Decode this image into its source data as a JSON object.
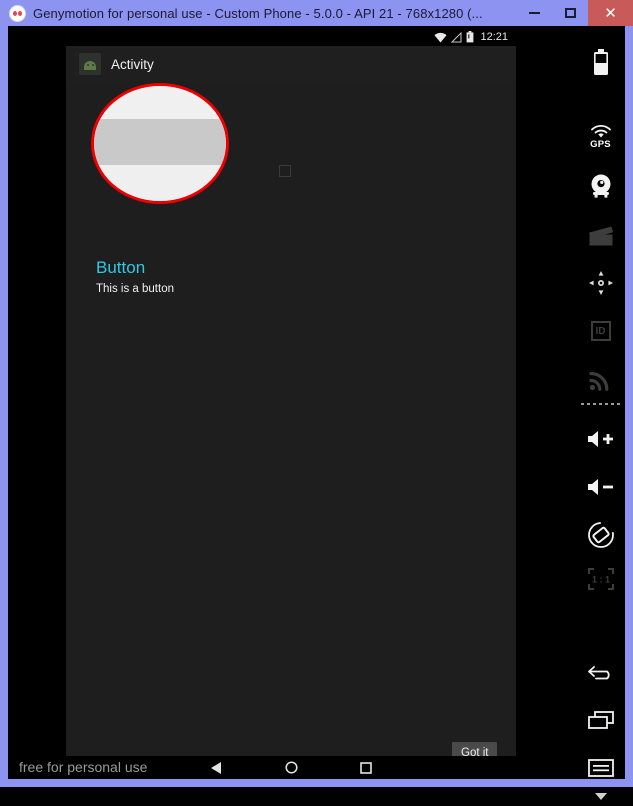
{
  "window": {
    "title": "Genymotion for personal use - Custom Phone - 5.0.0 - API 21 - 768x1280 (...",
    "logo_icon": "genymotion-logo-icon",
    "controls": {
      "minimize_label": "–",
      "maximize_label": "□",
      "close_label": "✕"
    },
    "accent_color": "#8c93f0",
    "close_color": "#c85a5a"
  },
  "android": {
    "status_bar": {
      "wifi_icon": "wifi-icon",
      "signal_icon": "signal-icon",
      "battery_icon": "battery-icon",
      "clock": "12:21"
    },
    "action_bar": {
      "app_icon": "android-app-icon",
      "title": "Activity"
    },
    "content": {
      "button_title": "Button",
      "button_subtitle": "This is a button",
      "button_title_color": "#2ec8e6",
      "placeholder_square_icon": "empty-square-icon",
      "got_it_label": "Got it"
    },
    "nav_bar": {
      "watermark": "free for personal use",
      "back_icon": "back-triangle-icon",
      "home_icon": "home-circle-icon",
      "recent_icon": "recent-square-icon"
    }
  },
  "annotation": {
    "shape": "circle",
    "color": "#ee0000",
    "name": "red-highlight-circle"
  },
  "toolbar": {
    "items": [
      {
        "name": "battery-widget-icon",
        "label": "",
        "enabled": true
      },
      {
        "name": "gps-icon",
        "label": "GPS",
        "enabled": true
      },
      {
        "name": "camera-icon",
        "label": "",
        "enabled": true
      },
      {
        "name": "video-clapperboard-icon",
        "label": "",
        "enabled": false
      },
      {
        "name": "accelerometer-dpad-icon",
        "label": "",
        "enabled": true
      },
      {
        "name": "identifiers-id-icon",
        "label": "ID",
        "enabled": false
      },
      {
        "name": "network-signal-icon",
        "label": "",
        "enabled": false
      },
      {
        "name": "volume-up-icon",
        "label": "",
        "enabled": true
      },
      {
        "name": "volume-down-icon",
        "label": "",
        "enabled": true
      },
      {
        "name": "rotate-screen-icon",
        "label": "",
        "enabled": true
      },
      {
        "name": "scale-one-to-one-icon",
        "label": "1 : 1",
        "enabled": false
      },
      {
        "name": "back-arrow-icon",
        "label": "",
        "enabled": true
      },
      {
        "name": "recent-apps-icon",
        "label": "",
        "enabled": true
      },
      {
        "name": "menu-icon",
        "label": "",
        "enabled": true
      },
      {
        "name": "expand-chevron-down-icon",
        "label": "",
        "enabled": true
      }
    ]
  }
}
